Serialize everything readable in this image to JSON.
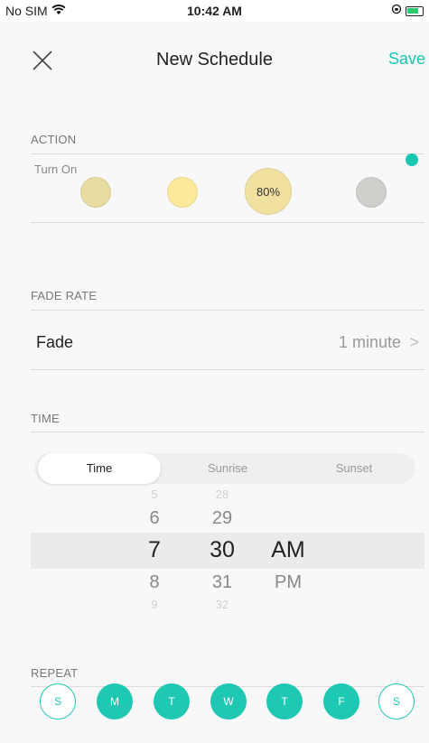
{
  "status_bar": {
    "carrier": "No SIM",
    "time": "10:42 AM"
  },
  "nav": {
    "title": "New Schedule",
    "save_label": "Save"
  },
  "action": {
    "section_label": "ACTION",
    "turn_on_label": "Turn On",
    "bulbs": [
      {
        "label": "",
        "color": "#e8dca0"
      },
      {
        "label": "",
        "color": "#fce99a"
      },
      {
        "label": "80%",
        "color": "#f1e1a0"
      },
      {
        "label": "",
        "color": "#cfcfcc"
      }
    ]
  },
  "fade_rate": {
    "section_label": "FADE RATE",
    "label": "Fade",
    "value": "1 minute",
    "chevron": ">"
  },
  "time": {
    "section_label": "TIME",
    "tabs": [
      "Time",
      "Sunrise",
      "Sunset"
    ],
    "active_tab": "Time",
    "hours": [
      "5",
      "6",
      "7",
      "8",
      "9"
    ],
    "minutes": [
      "28",
      "29",
      "30",
      "31",
      "32"
    ],
    "periods": [
      "AM",
      "PM"
    ],
    "selected": {
      "hour": "7",
      "minute": "30",
      "period": "AM"
    }
  },
  "repeat": {
    "section_label": "REPEAT",
    "days": [
      {
        "label": "S",
        "on": false
      },
      {
        "label": "M",
        "on": true
      },
      {
        "label": "T",
        "on": true
      },
      {
        "label": "W",
        "on": true
      },
      {
        "label": "T",
        "on": true
      },
      {
        "label": "F",
        "on": true
      },
      {
        "label": "S",
        "on": false
      }
    ]
  },
  "colors": {
    "accent": "#17c7b3"
  }
}
